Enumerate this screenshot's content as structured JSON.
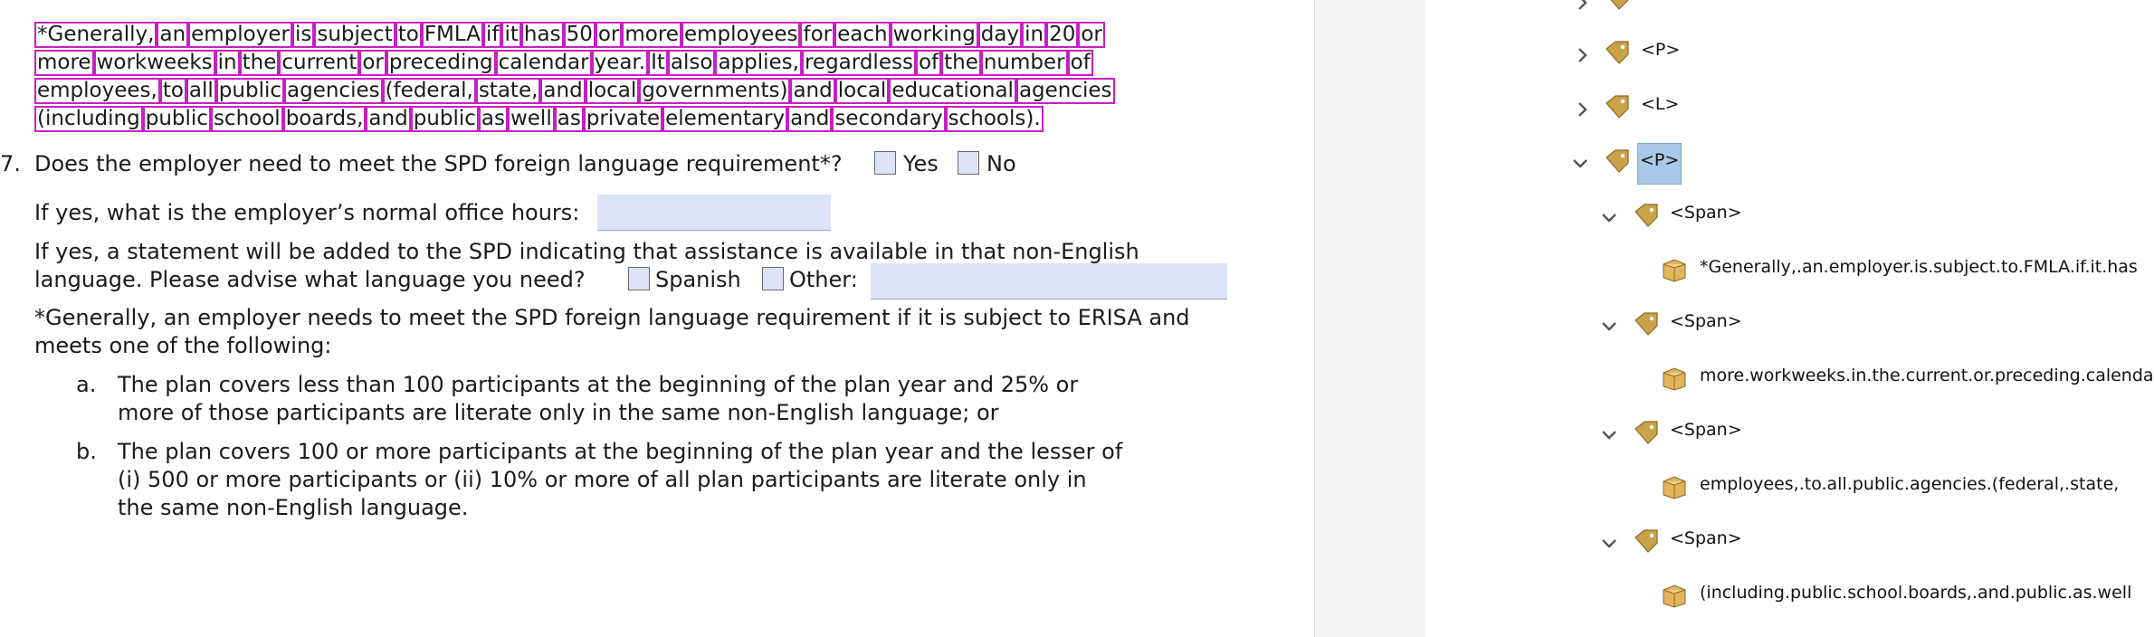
{
  "document": {
    "highlight_lines": [
      [
        "*Generally,",
        "an",
        "employer",
        "is",
        "subject",
        "to",
        "FMLA",
        "if",
        "it",
        "has",
        "50",
        "or",
        "more",
        "employees",
        "for",
        "each",
        "working",
        "day",
        "in",
        "20",
        "or"
      ],
      [
        "more",
        "workweeks",
        "in",
        "the",
        "current",
        "or",
        "preceding",
        "calendar",
        "year.",
        "It",
        "also",
        "applies,",
        "regardless",
        "of",
        "the",
        "number",
        "of"
      ],
      [
        "employees,",
        "to",
        "all",
        "public",
        "agencies",
        "(federal,",
        "state,",
        "and",
        "local",
        "governments)",
        "and",
        "local",
        "educational",
        "agencies"
      ],
      [
        "(including",
        "public",
        "school",
        "boards,",
        "and",
        "public",
        "as",
        "well",
        "as",
        "private",
        "elementary",
        "and",
        "secondary",
        "schools)."
      ]
    ],
    "question_number": "7.",
    "question_text": "Does the employer need to meet the SPD foreign language requirement*?",
    "yes_label": "Yes",
    "no_label": "No",
    "hours_text": "If yes, what is the employer’s normal office hours:",
    "statement_line1": "If yes, a statement will be added to the SPD indicating that assistance is available in that non-English",
    "statement_line2": "language.  Please advise what language you need?",
    "spanish_label": "Spanish",
    "other_label": "Other:",
    "generally_line1": "*Generally, an employer needs to meet the SPD foreign language requirement if it is subject to ERISA and",
    "generally_line2": "meets one of the following:",
    "item_a_marker": "a.",
    "item_a_line1": "The plan covers less than 100 participants at the beginning of the plan year and 25% or",
    "item_a_line2": "more of those participants are literate only in the same non-English language; or",
    "item_b_marker": "b.",
    "item_b_line1": "The plan covers 100 or more participants at the beginning of the plan year and the lesser of",
    "item_b_line2": "(i) 500 or more participants or (ii) 10% or more of all plan participants are literate only in",
    "item_b_line3": "the same non-English language.",
    "highlight_color": "#c71fc3",
    "field_color": "#dde3f8"
  },
  "tags_tree": {
    "nodes": [
      {
        "label": "<P>",
        "state": "collapsed",
        "icon": "tag-icon"
      },
      {
        "label": "<L>",
        "state": "collapsed",
        "icon": "tag-icon"
      },
      {
        "label": "<P>",
        "state": "expanded",
        "icon": "tag-icon",
        "selected": true
      },
      {
        "label": "<Span>",
        "state": "expanded",
        "icon": "tag-icon"
      },
      {
        "label": "*Generally,.an.employer.is.subject.to.FMLA.if.it.has",
        "icon": "content-box-icon"
      },
      {
        "label": "<Span>",
        "state": "expanded",
        "icon": "tag-icon"
      },
      {
        "label": "more.workweeks.in.the.current.or.preceding.calendar",
        "icon": "content-box-icon"
      },
      {
        "label": "<Span>",
        "state": "expanded",
        "icon": "tag-icon"
      },
      {
        "label": "employees,.to.all.public.agencies.(federal,.state,",
        "icon": "content-box-icon"
      },
      {
        "label": "<Span>",
        "state": "expanded",
        "icon": "tag-icon"
      },
      {
        "label": "(including.public.school.boards,.and.public.as.well",
        "icon": "content-box-icon"
      }
    ],
    "selected_color": "#a9c8e6"
  }
}
